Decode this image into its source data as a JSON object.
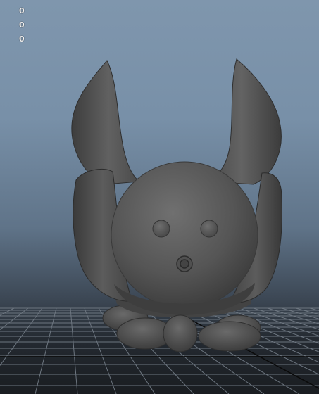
{
  "hud": {
    "readout_1": "0",
    "readout_2": "0",
    "readout_3": "0"
  },
  "colors": {
    "background_top": "#7f96ad",
    "background_bottom": "#1a1d21",
    "grid_line": "#6d7680",
    "grid_axis": "#0a0a0a",
    "model_shade": "#4b4b4b"
  }
}
